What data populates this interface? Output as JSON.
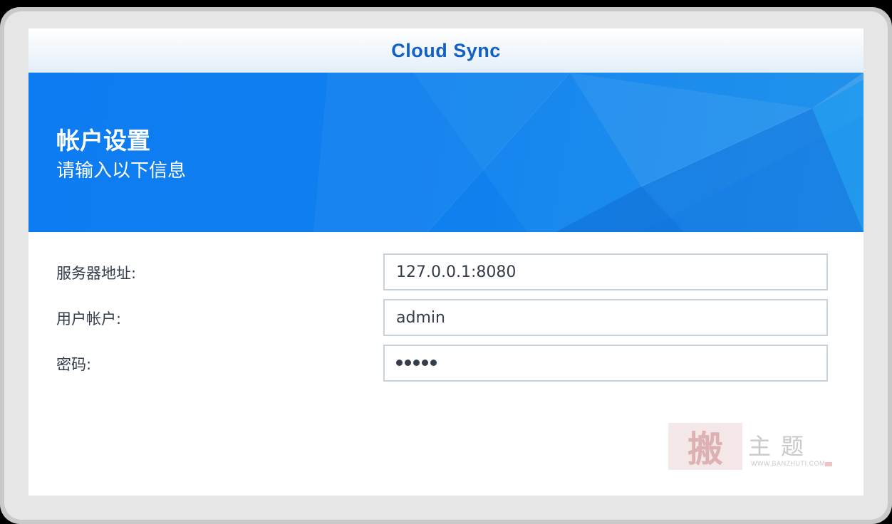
{
  "window": {
    "title": "Cloud Sync"
  },
  "banner": {
    "title": "帐户设置",
    "subtitle": "请输入以下信息"
  },
  "form": {
    "server": {
      "label": "服务器地址:",
      "value": "127.0.0.1:8080"
    },
    "account": {
      "label": "用户帐户:",
      "value": "admin"
    },
    "password": {
      "label": "密码:",
      "masked_length": 5
    }
  },
  "watermark": {
    "seal": "搬",
    "text": "主题",
    "url": "WWW.BANZHUTI.COM"
  },
  "colors": {
    "title": "#1160c3",
    "banner": "#0d7cf2",
    "label": "#333d4a",
    "input_border": "#c7d2dc"
  }
}
